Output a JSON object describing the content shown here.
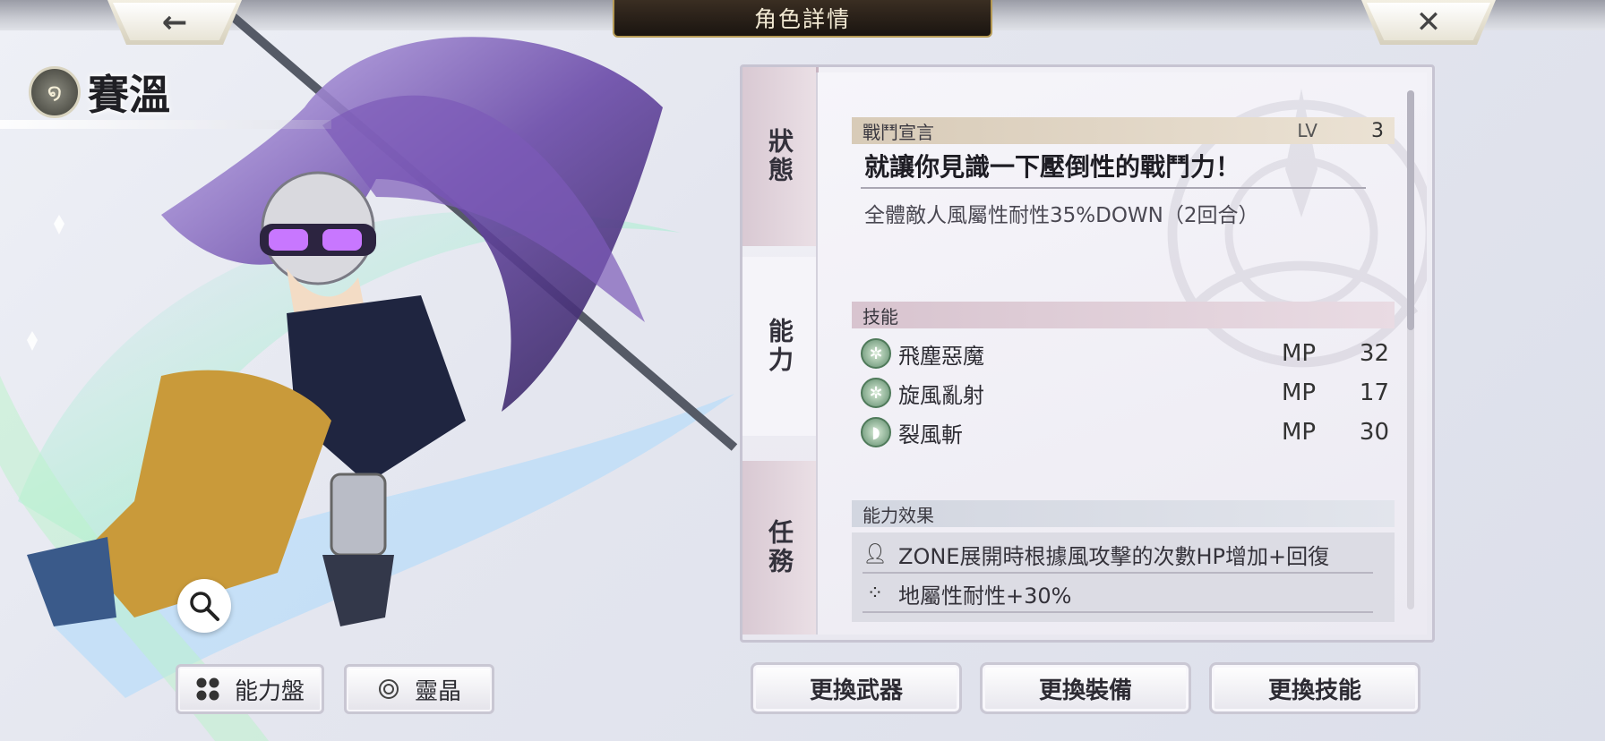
{
  "header": {
    "title": "角色詳情",
    "back_icon": "←",
    "close_icon": "✕"
  },
  "character": {
    "name": "賽溫",
    "element_icon": "wind"
  },
  "left_buttons": [
    {
      "label": "能力盤",
      "icon": "grid-icon"
    },
    {
      "label": "靈晶",
      "icon": "crystal-icon"
    }
  ],
  "tabs": [
    {
      "label": "狀態",
      "active": false
    },
    {
      "label": "能力",
      "active": true
    },
    {
      "label": "任務",
      "active": false
    }
  ],
  "battle_declaration": {
    "header": "戰鬥宣言",
    "lv_label": "LV",
    "lv_value": "3",
    "line": "就讓你見識一下壓倒性的戰鬥力！",
    "description": "全體敵人風屬性耐性35%DOWN（2回合）"
  },
  "skills": {
    "header": "技能",
    "items": [
      {
        "name": "飛塵惡魔",
        "mp_label": "MP",
        "mp": "32"
      },
      {
        "name": "旋風亂射",
        "mp_label": "MP",
        "mp": "17"
      },
      {
        "name": "裂風斬",
        "mp_label": "MP",
        "mp": "30"
      }
    ]
  },
  "ability_effects": {
    "header": "能力效果",
    "items": [
      {
        "text": "ZONE展開時根據風攻擊的次數HP增加+回復"
      },
      {
        "text": "地屬性耐性+30%"
      }
    ]
  },
  "actions": {
    "weapon": "更換武器",
    "equipment": "更換裝備",
    "skill": "更換技能"
  },
  "colors": {
    "accent_gold": "#b59a55",
    "title_plate": "#1a1410",
    "skill_green": "#5d8a6a"
  }
}
